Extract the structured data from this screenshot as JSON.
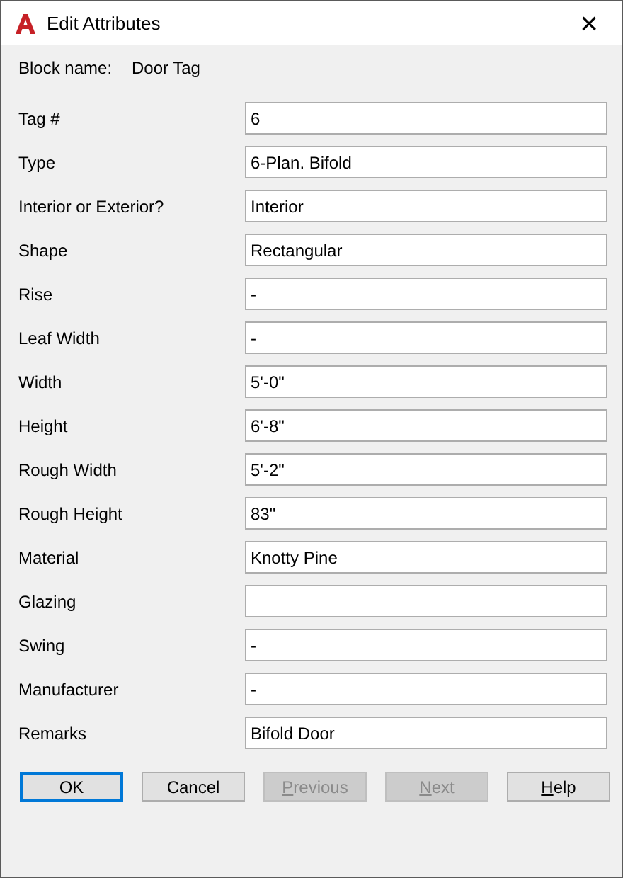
{
  "window": {
    "title": "Edit Attributes",
    "close": "×"
  },
  "block": {
    "label": "Block name:",
    "value": "Door Tag"
  },
  "fields": [
    {
      "label": "Tag #",
      "value": "6"
    },
    {
      "label": "Type",
      "value": "6-Plan. Bifold"
    },
    {
      "label": "Interior or Exterior?",
      "value": "Interior"
    },
    {
      "label": "Shape",
      "value": "Rectangular"
    },
    {
      "label": "Rise",
      "value": "-"
    },
    {
      "label": "Leaf Width",
      "value": "-"
    },
    {
      "label": "Width",
      "value": "5'-0\""
    },
    {
      "label": "Height",
      "value": "6'-8\""
    },
    {
      "label": "Rough Width",
      "value": "5'-2\""
    },
    {
      "label": "Rough Height",
      "value": "83\""
    },
    {
      "label": "Material",
      "value": "Knotty Pine"
    },
    {
      "label": "Glazing"
    },
    {
      "label": "Swing",
      "value": "-"
    },
    {
      "label": "Manufacturer",
      "value": "-"
    },
    {
      "label": "Remarks",
      "value": "Bifold Door"
    }
  ],
  "buttons": [
    {
      "label": "OK",
      "disabled": false,
      "default": true,
      "mnemonic": false
    },
    {
      "label": "Cancel",
      "disabled": false,
      "default": false,
      "mnemonic": false
    },
    {
      "label": "Previous",
      "disabled": true,
      "default": false,
      "mnemonic": true
    },
    {
      "label": "Next",
      "disabled": true,
      "default": false,
      "mnemonic": true
    },
    {
      "label": "Help",
      "disabled": false,
      "default": false,
      "mnemonic": true
    }
  ]
}
